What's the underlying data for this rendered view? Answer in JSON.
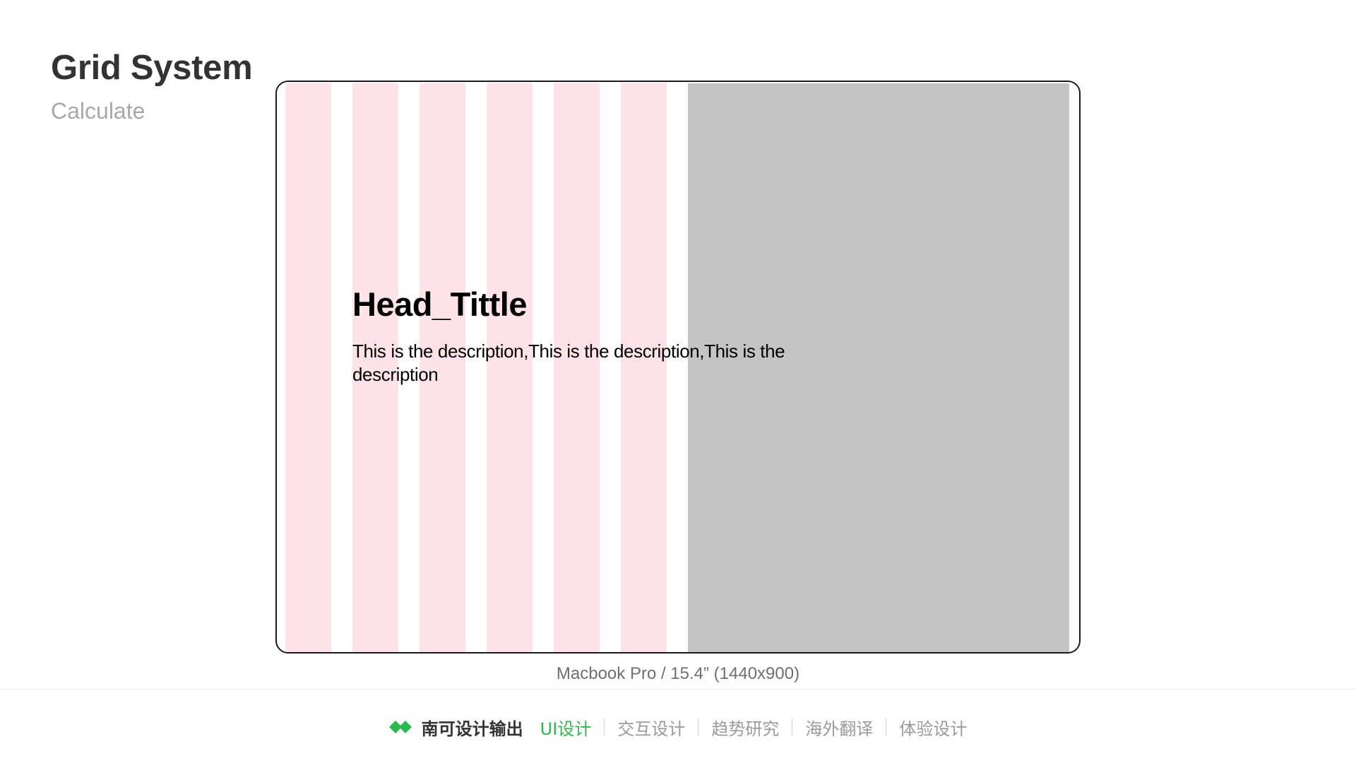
{
  "header": {
    "title": "Grid System",
    "subtitle": "Calculate"
  },
  "mockup": {
    "head_title": "Head_Tittle",
    "description": "This is the description,This is the description,This is the description",
    "caption": "Macbook Pro / 15.4” (1440x900)",
    "colors": {
      "grid_column": "#fde3e8",
      "panel": "#c4c4c4",
      "frame": "#1a1a1a"
    }
  },
  "footer": {
    "brand_icon": "double-diamond-icon",
    "brand_name": "南可设计输出",
    "nav": [
      {
        "label": "UI设计",
        "active": true
      },
      {
        "label": "交互设计",
        "active": false
      },
      {
        "label": "趋势研究",
        "active": false
      },
      {
        "label": "海外翻译",
        "active": false
      },
      {
        "label": "体验设计",
        "active": false
      }
    ],
    "colors": {
      "accent": "#2db84d"
    }
  }
}
